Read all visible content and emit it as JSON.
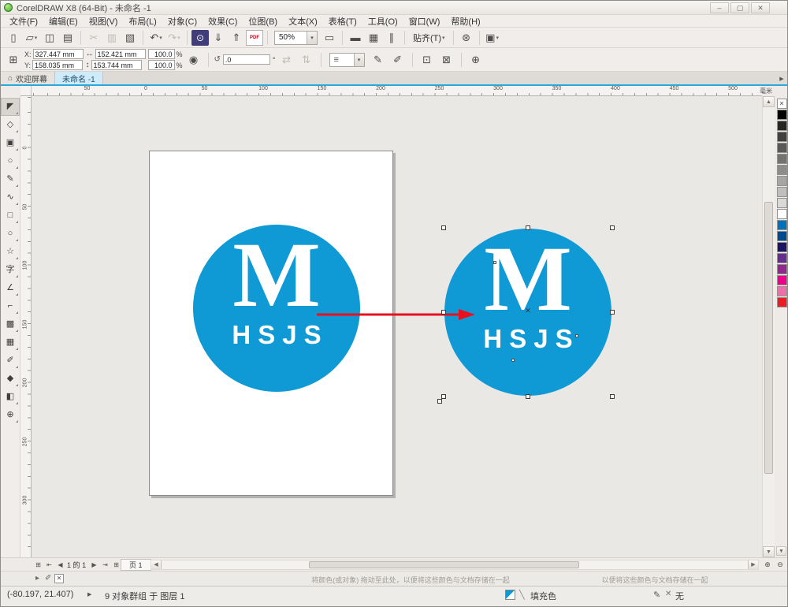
{
  "colors": {
    "logo_blue": "#0f9ad6",
    "arrow_red": "#e8101d",
    "accent": "#2ba7dc",
    "active_tab_bg": "#cfeaf8"
  },
  "title_bar": {
    "title": "CorelDRAW X8 (64-Bit) - 未命名 -1"
  },
  "menu_bar": {
    "items": [
      "文件(F)",
      "编辑(E)",
      "视图(V)",
      "布局(L)",
      "对象(C)",
      "效果(C)",
      "位图(B)",
      "文本(X)",
      "表格(T)",
      "工具(O)",
      "窗口(W)",
      "帮助(H)"
    ]
  },
  "standard_toolbar": {
    "zoom_level": "50%",
    "snap_label": "贴齐(T)",
    "pdf_label": "PDF"
  },
  "property_bar": {
    "x_label": "X:",
    "x_value": "327.447 mm",
    "y_label": "Y:",
    "y_value": "158.035 mm",
    "width_value": "152.421 mm",
    "height_value": "153.744 mm",
    "scale_h": "100.0",
    "scale_v": "100.0",
    "percent": "%",
    "angle_value": ".0",
    "degree": "°"
  },
  "document_tabs": {
    "welcome_label": "欢迎屏幕",
    "doc_label": "未命名 -1"
  },
  "rulers": {
    "horizontal_labels": [
      "50",
      "0",
      "50",
      "100",
      "150",
      "200",
      "250",
      "300",
      "350",
      "400",
      "450",
      "500"
    ],
    "vertical_labels": [
      "0",
      "50",
      "100",
      "150",
      "200",
      "250",
      "300"
    ],
    "units_label": "毫米"
  },
  "toolbox": {
    "tools": [
      {
        "name": "pick-tool",
        "glyph": "◤"
      },
      {
        "name": "shape-tool",
        "glyph": "◇"
      },
      {
        "name": "crop-tool",
        "glyph": "▣"
      },
      {
        "name": "zoom-tool",
        "glyph": "○"
      },
      {
        "name": "freehand-tool",
        "glyph": "✎"
      },
      {
        "name": "artistic-media-tool",
        "glyph": "∿"
      },
      {
        "name": "rectangle-tool",
        "glyph": "□"
      },
      {
        "name": "ellipse-tool",
        "glyph": "○"
      },
      {
        "name": "polygon-tool",
        "glyph": "☆"
      },
      {
        "name": "text-tool",
        "glyph": "字"
      },
      {
        "name": "parallel-dimension-tool",
        "glyph": "∠"
      },
      {
        "name": "connector-tool",
        "glyph": "⌐"
      },
      {
        "name": "drop-shadow-tool",
        "glyph": "▩"
      },
      {
        "name": "mesh-fill-tool",
        "glyph": "▦"
      },
      {
        "name": "color-eyedropper-tool",
        "glyph": "✐"
      },
      {
        "name": "interactive-fill-tool",
        "glyph": "◆"
      },
      {
        "name": "smart-fill-tool",
        "glyph": "◧"
      },
      {
        "name": "more-tools",
        "glyph": "⊕"
      }
    ]
  },
  "canvas": {
    "logo": {
      "letter": "M",
      "subtext": "HSJS"
    }
  },
  "color_palette": {
    "swatches": [
      "none",
      "#000000",
      "#262626",
      "#404040",
      "#595959",
      "#737373",
      "#8c8c8c",
      "#a6a6a6",
      "#bfbfbf",
      "#d9d9d9",
      "#ffffff",
      "#0072bc",
      "#004a8f",
      "#1b1464",
      "#662d91",
      "#92278f",
      "#ec008c",
      "#f06eaa",
      "#ed1c24"
    ]
  },
  "page_navigation": {
    "current_page": "1",
    "of_label": "的",
    "total_pages": "1",
    "page_tab_label": "页 1"
  },
  "document_palette": {
    "hint_left": "将颜色(或对象) 拖动至此处，以便将这些颜色与文档存储在一起",
    "hint_right": "以便将这些颜色与文档存储在一起"
  },
  "status_bar": {
    "cursor_position": "(-80.197, 21.407)",
    "selection_info": "9 对象群组 于 图层 1",
    "fill_label": "填充色",
    "outline_label": "无"
  },
  "icons": {
    "minimize": "–",
    "maximize": "▢",
    "close": "✕",
    "home": "⌂",
    "tab-scroll-right": "▶",
    "new-document": "▯",
    "open": "▱",
    "save": "◫",
    "print": "▤",
    "cut": "✂",
    "copy": "▥",
    "paste": "▧",
    "undo": "↶",
    "redo": "↷",
    "search-content": "⊙",
    "import": "⇓",
    "export": "⇑",
    "dropdown": "▾",
    "fullscreen": "▭",
    "show-rulers": "▬",
    "show-grid": "▦",
    "show-guidelines": "∥",
    "options": "⊛",
    "launcher": "▣",
    "position": "⊞",
    "width": "↔",
    "height": "↕",
    "lock": "◉",
    "rotate": "↺",
    "mirror-h": "⇄",
    "mirror-v": "⇅",
    "outline-width": "≡",
    "edit-fill": "✎",
    "edit-outline": "✐",
    "group": "⊡",
    "ungroup": "⊠",
    "plus": "⊕",
    "nav-first": "⇤",
    "nav-prev": "◀",
    "nav-next": "▶",
    "nav-last": "⇥",
    "add-page": "⊞",
    "scroll-up": "▲",
    "scroll-down": "▼",
    "scroll-left": "◀",
    "scroll-right": "▶",
    "palette-more": "▼",
    "palette-open": "⊞",
    "flyout": "▸",
    "eyedropper": "✐",
    "no-color": "✕",
    "status-marker": "▶",
    "pen": "✎",
    "none-x": "✕",
    "center-x": "✕",
    "slash": "╲",
    "quick-zoom": "⊕",
    "quick-pan": "⊖"
  }
}
